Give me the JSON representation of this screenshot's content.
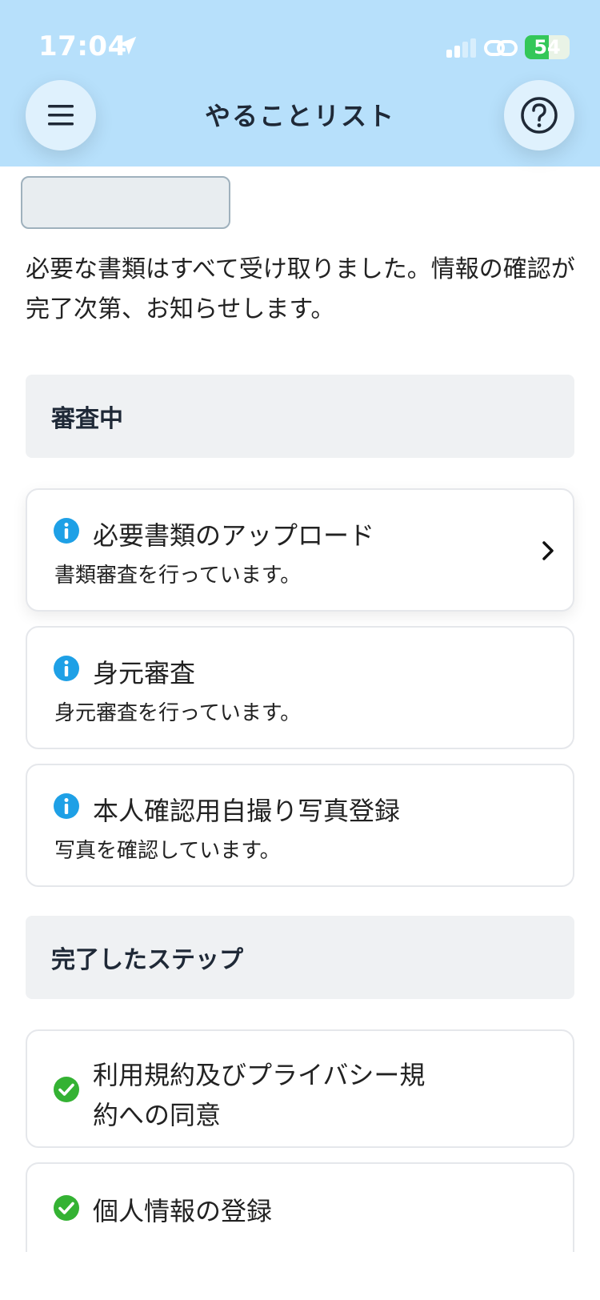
{
  "status_bar": {
    "time": "17:04",
    "battery": "54",
    "battery_percent": 54
  },
  "header": {
    "title": "やることリスト"
  },
  "intro": "必要な書類はすべて受け取りました。情報の確認が完了次第、お知らせします。",
  "review_section": {
    "title": "審査中",
    "items": [
      {
        "title": "必要書類のアップロード",
        "subtitle": "書類審査を行っています。"
      },
      {
        "title": "身元審査",
        "subtitle": "身元審査を行っています。"
      },
      {
        "title": "本人確認用自撮り写真登録",
        "subtitle": "写真を確認しています。"
      }
    ]
  },
  "completed_section": {
    "title": "完了したステップ",
    "items": [
      {
        "title_line1": "利用規約及びプライバシー規",
        "title_line2": "約への同意"
      },
      {
        "title": "個人情報の登録"
      }
    ]
  },
  "colors": {
    "header_bg": "#b7e0fb",
    "info": "#1ea0e6",
    "success": "#34b233"
  },
  "icons": [
    "location-arrow-icon",
    "signal-icon",
    "link-icon",
    "battery-icon",
    "menu-icon",
    "help-icon",
    "info-icon",
    "chevron-right-icon",
    "check-circle-icon"
  ]
}
